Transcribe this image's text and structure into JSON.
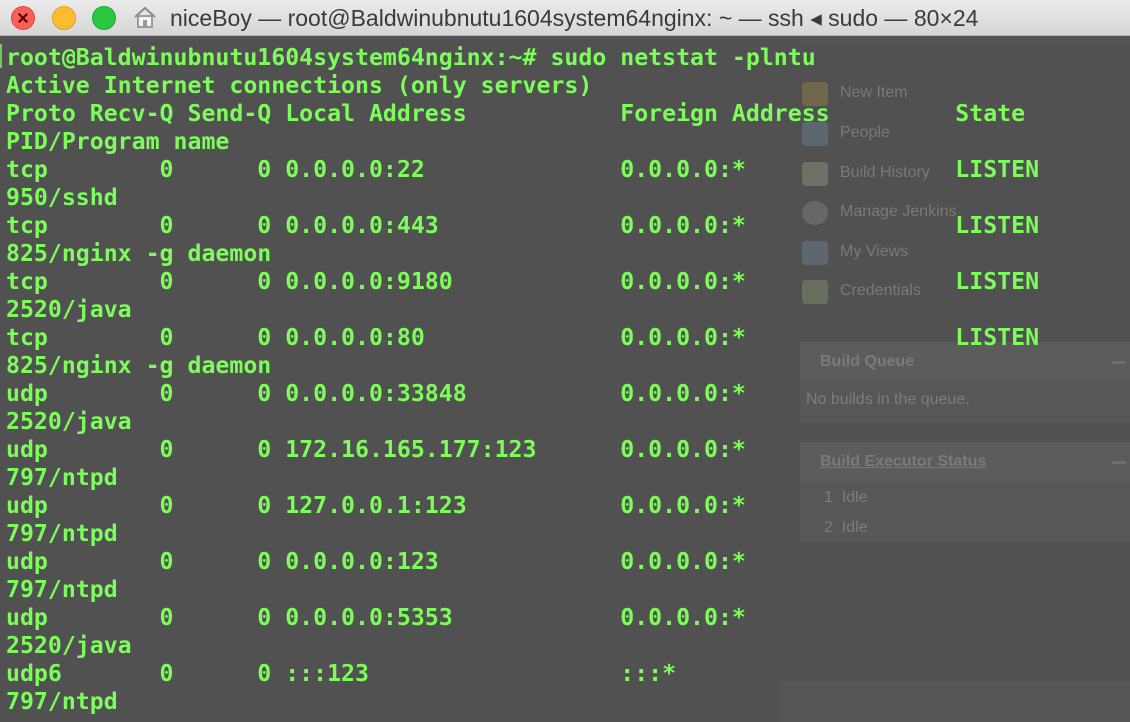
{
  "window": {
    "title": "niceBoy — root@Baldwinubnutu1604system64nginx: ~ — ssh ◂ sudo — 80×24",
    "controls": [
      "close-button",
      "minimize-button",
      "maximize-button"
    ],
    "icon": "home-icon"
  },
  "terminal": {
    "text_color": "#7dfc5b",
    "background_color": "#515151",
    "lines": [
      "root@Baldwinubnutu1604system64nginx:~# sudo netstat -plntu",
      "Active Internet connections (only servers)",
      "Proto Recv-Q Send-Q Local Address           Foreign Address         State",
      "PID/Program name",
      "tcp        0      0 0.0.0.0:22              0.0.0.0:*               LISTEN",
      "950/sshd",
      "tcp        0      0 0.0.0.0:443             0.0.0.0:*               LISTEN",
      "825/nginx -g daemon",
      "tcp        0      0 0.0.0.0:9180            0.0.0.0:*               LISTEN",
      "2520/java",
      "tcp        0      0 0.0.0.0:80              0.0.0.0:*               LISTEN",
      "825/nginx -g daemon",
      "udp        0      0 0.0.0.0:33848           0.0.0.0:*",
      "2520/java",
      "udp        0      0 172.16.165.177:123      0.0.0.0:*",
      "797/ntpd",
      "udp        0      0 127.0.0.1:123           0.0.0.0:*",
      "797/ntpd",
      "udp        0      0 0.0.0.0:123             0.0.0.0:*",
      "797/ntpd",
      "udp        0      0 0.0.0.0:5353            0.0.0.0:*",
      "2520/java",
      "udp6       0      0 :::123                  :::*",
      "797/ntpd"
    ]
  },
  "background_page": {
    "tasks": [
      {
        "label": "New Item",
        "icon": "folder-icon"
      },
      {
        "label": "People",
        "icon": "people-icon"
      },
      {
        "label": "Build History",
        "icon": "notepad-icon"
      },
      {
        "label": "Manage Jenkins",
        "icon": "gear-icon"
      },
      {
        "label": "My Views",
        "icon": "people-icon"
      },
      {
        "label": "Credentials",
        "icon": "key-icon"
      }
    ],
    "build_queue": {
      "title": "Build Queue",
      "empty_text": "No builds in the queue."
    },
    "build_executor": {
      "title": "Build Executor Status",
      "executors": [
        {
          "number": "1",
          "status": "Idle"
        },
        {
          "number": "2",
          "status": "Idle"
        }
      ]
    }
  }
}
